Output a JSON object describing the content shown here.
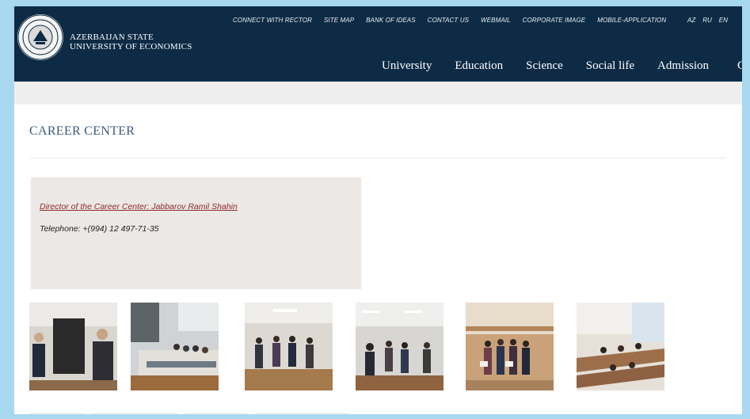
{
  "header": {
    "university_name": [
      "AZERBAIJAN STATE",
      "UNIVERSITY OF ECONOMICS"
    ],
    "top_links": [
      "CONNECT WITH RECTOR",
      "SITE MAP",
      "BANK OF IDEAS",
      "CONTACT US",
      "WEBMAIL",
      "CORPORATE IMAGE",
      "MOBILE-APPLICATION"
    ],
    "languages": [
      "AZ",
      "RU",
      "EN"
    ],
    "nav": [
      "University",
      "Education",
      "Science",
      "Social life",
      "Admission"
    ],
    "nav_cut": "C"
  },
  "page": {
    "title": "CAREER CENTER",
    "director_link": "Director of the Career Center: Jabbarov  Ramil Shahin",
    "telephone": "Telephone: +(994) 12 497-71-35"
  },
  "gallery": {
    "photos": [
      "career-center-photo-1",
      "career-center-photo-2",
      "career-center-photo-3",
      "career-center-photo-4",
      "career-center-photo-5",
      "career-center-photo-6"
    ]
  },
  "colors": {
    "header_bg": "#0d2b45",
    "title": "#3c5a78",
    "link": "#8e2a2a",
    "info_box_bg": "#ebe8e5",
    "frame_border": "#a8d8f0"
  }
}
